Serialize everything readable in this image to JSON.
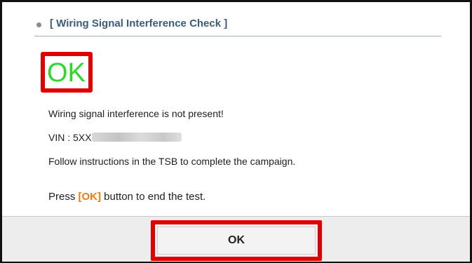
{
  "section": {
    "title": "[ Wiring Signal Interference Check ]"
  },
  "status": {
    "result": "OK",
    "result_color": "#2dd72d",
    "highlight_color": "#e00000"
  },
  "messages": {
    "line1": "Wiring signal interference is not present!",
    "vin_label": "VIN : 5XX",
    "line3": "Follow instructions in the TSB to complete the campaign.",
    "press_prefix": "Press ",
    "press_ok": "[OK]",
    "press_suffix": " button to end the test."
  },
  "footer": {
    "ok_button_label": "OK"
  }
}
